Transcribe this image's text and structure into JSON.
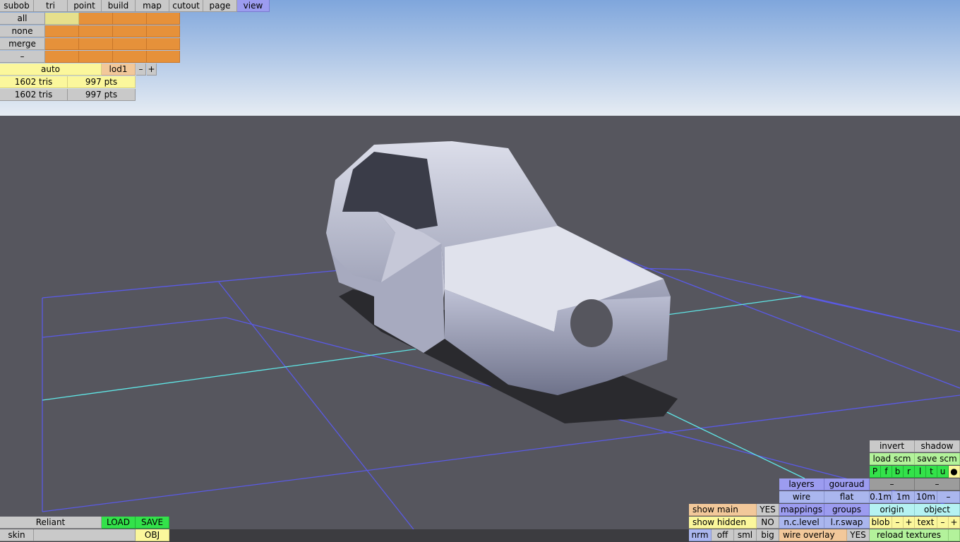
{
  "top_tabs": [
    "subob",
    "tri",
    "point",
    "build",
    "map",
    "cutout",
    "page",
    "view"
  ],
  "subob_buttons": [
    "all",
    "none",
    "merge",
    "–"
  ],
  "lod": {
    "auto": "auto",
    "name": "lod1",
    "minus": "–",
    "plus": "+"
  },
  "stats": [
    {
      "tris": "1602 tris",
      "pts": "997 pts"
    },
    {
      "tris": "1602 tris",
      "pts": "997 pts"
    }
  ],
  "bottom_left": {
    "name": "Reliant",
    "load": "LOAD",
    "save": "SAVE",
    "skin": "skin",
    "obj": "OBJ"
  },
  "right_panel": {
    "invert": "invert",
    "shadow": "shadow",
    "load_scm": "load scm",
    "save_scm": "save scm",
    "view_letters": [
      "P",
      "f",
      "b",
      "r",
      "l",
      "t",
      "u",
      "●"
    ],
    "dash": "–",
    "layers": "layers",
    "gouraud": "gouraud",
    "wire": "wire",
    "flat": "flat",
    "grid_sizes": [
      "0.1m",
      "1m",
      "10m"
    ],
    "mappings": "mappings",
    "groups": "groups",
    "origin": "origin",
    "object": "object",
    "show_main": "show main",
    "show_main_val": "YES",
    "show_hidden": "show hidden",
    "show_hidden_val": "NO",
    "nc_level": "n.c.level",
    "lr_swap": "l.r.swap",
    "blob": "blob",
    "text": "text",
    "plus": "+",
    "nrm": "nrm",
    "off": "off",
    "sml": "sml",
    "big": "big",
    "wire_overlay": "wire overlay",
    "wire_overlay_val": "YES",
    "reload_textures": "reload textures"
  }
}
